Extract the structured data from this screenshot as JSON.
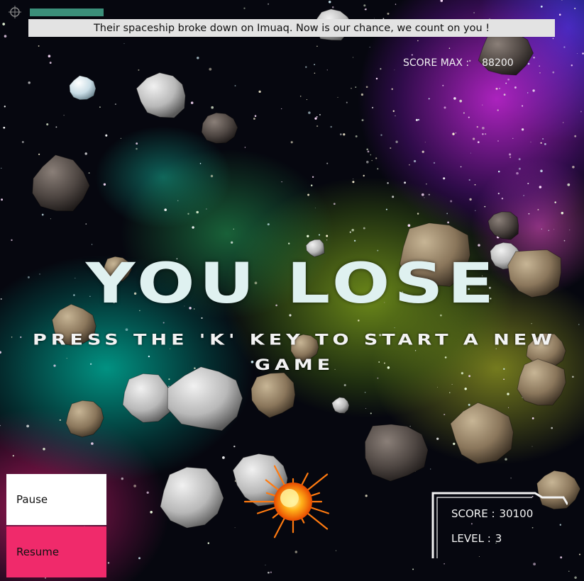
{
  "message": "Their spaceship broke down on Imuaq. Now is our chance, we count on you !",
  "score_max": {
    "label": "SCORE MAX :",
    "value": "88200"
  },
  "game_over": {
    "title": "YOU LOSE",
    "subtitle": "PRESS THE 'K' KEY TO START A NEW GAME"
  },
  "controls": {
    "pause_label": "Pause",
    "resume_label": "Resume"
  },
  "hud": {
    "score_label": "SCORE :",
    "score_value": "30100",
    "level_label": "LEVEL :",
    "level_value": "3"
  },
  "health": {
    "fraction": 0.14
  },
  "colors": {
    "health_bar": "#3b8f7a",
    "message_bar": "#e3e3e3",
    "resume_button": "#f02a6b",
    "pause_button": "#ffffff",
    "title_text": "#dff1f0"
  },
  "icons": {
    "corner": "crosshair-icon",
    "explosion": "explosion-icon"
  }
}
